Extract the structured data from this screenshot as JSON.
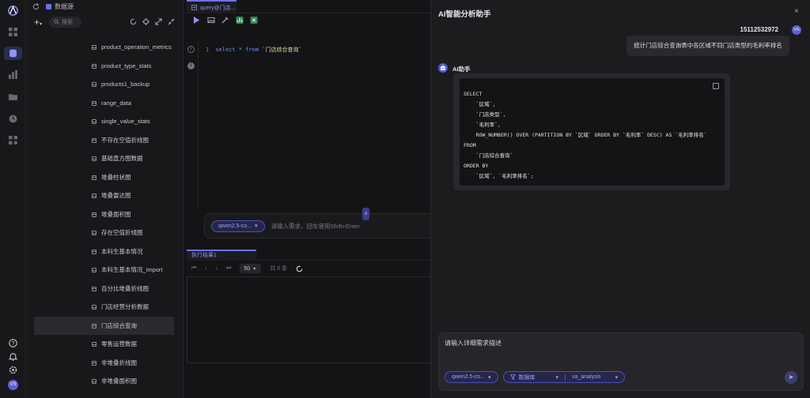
{
  "colors": {
    "accent": "#6a72e8",
    "background": "#141416",
    "panel": "#1c1c1f"
  },
  "rail": {
    "avatar_text": "VS",
    "icons": [
      "logo-icon",
      "grid-icon",
      "database-icon",
      "chart-icon",
      "folder-icon",
      "clock-icon",
      "apps-icon",
      "help-icon",
      "bell-icon",
      "settings-icon"
    ]
  },
  "tree": {
    "breadcrumb": "数据源",
    "search_placeholder": "搜索",
    "items": [
      "product_operation_metrics",
      "product_type_stats",
      "products1_backup",
      "range_data",
      "single_value_stats",
      "不存在空值折线图",
      "基础直方图数据",
      "堆叠柱状图",
      "堆叠雷达图",
      "堆叠面积图",
      "存在空值折线图",
      "本科生基本情况",
      "本科生基本情况_import",
      "百分比堆叠折线图",
      "门店经营分析数据",
      "门店综合查询",
      "零售运营数据",
      "非堆叠折线图",
      "非堆叠面积图"
    ]
  },
  "editor": {
    "tab_label": "query@门店...",
    "line_number": "1",
    "code_select": "select",
    "code_star": "*",
    "code_from": "from",
    "code_table": "`门店综合查询`",
    "model_pill": "qwen2.5-co...",
    "chat_placeholder": "请输入需求，回车使用Shift+Enter",
    "result_tab": "执行结果1",
    "page_size": "50",
    "total": "共 0 条"
  },
  "ai": {
    "title": "AI智能分析助手",
    "close": "×",
    "user_name": "15112532972",
    "user_avatar": "VS",
    "user_message": "统计门店综合查询表中各区域不同门店类型的毛利率排名",
    "bot_name": "AI助手",
    "sql_code": "SELECT\n    `区域`,\n    `门店类型`,\n    `毛利率`,\n    ROW_NUMBER() OVER (PARTITION BY `区域` ORDER BY `毛利率` DESC) AS `毛利率排名`\nFROM\n    `门店综合查询`\nORDER BY\n    `区域`, `毛利率排名`;",
    "input_placeholder": "请输入详细需求描述",
    "model_pill": "qwen2.5-co...",
    "db_label": "数据库",
    "db_value": "va_analysis"
  }
}
